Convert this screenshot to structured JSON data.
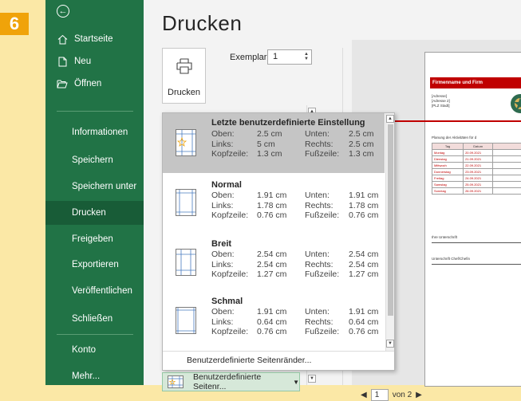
{
  "step": "6",
  "sidebar": {
    "top_items": [
      {
        "label": "Startseite",
        "icon": "home-icon"
      },
      {
        "label": "Neu",
        "icon": "new-document-icon"
      },
      {
        "label": "Öffnen",
        "icon": "folder-open-icon"
      }
    ],
    "items": [
      {
        "label": "Informationen"
      },
      {
        "label": "Speichern"
      },
      {
        "label": "Speichern unter"
      },
      {
        "label": "Drucken",
        "active": true
      },
      {
        "label": "Freigeben"
      },
      {
        "label": "Exportieren"
      },
      {
        "label": "Veröffentlichen"
      },
      {
        "label": "Schließen"
      }
    ],
    "bottom_items": [
      {
        "label": "Konto"
      },
      {
        "label": "Mehr..."
      }
    ]
  },
  "main": {
    "title": "Drucken",
    "print_button_label": "Drucken",
    "copies_label": "Exemplare:",
    "copies_value": "1"
  },
  "margin_dropdown": {
    "options": [
      {
        "title": "Letzte benutzerdefinierte Einstellung",
        "selected": true,
        "top_label": "Oben:",
        "top": "2.5 cm",
        "bottom_label": "Unten:",
        "bottom": "2.5 cm",
        "left_label": "Links:",
        "left": "5 cm",
        "right_label": "Rechts:",
        "right": "2.5 cm",
        "header_label": "Kopfzeile:",
        "header": "1.3 cm",
        "footer_label": "Fußzeile:",
        "footer": "1.3 cm"
      },
      {
        "title": "Normal",
        "top_label": "Oben:",
        "top": "1.91 cm",
        "bottom_label": "Unten:",
        "bottom": "1.91 cm",
        "left_label": "Links:",
        "left": "1.78 cm",
        "right_label": "Rechts:",
        "right": "1.78 cm",
        "header_label": "Kopfzeile:",
        "header": "0.76 cm",
        "footer_label": "Fußzeile:",
        "footer": "0.76 cm"
      },
      {
        "title": "Breit",
        "top_label": "Oben:",
        "top": "2.54 cm",
        "bottom_label": "Unten:",
        "bottom": "2.54 cm",
        "left_label": "Links:",
        "left": "2.54 cm",
        "right_label": "Rechts:",
        "right": "2.54 cm",
        "header_label": "Kopfzeile:",
        "header": "1.27 cm",
        "footer_label": "Fußzeile:",
        "footer": "1.27 cm"
      },
      {
        "title": "Schmal",
        "top_label": "Oben:",
        "top": "1.91 cm",
        "bottom_label": "Unten:",
        "bottom": "1.91 cm",
        "left_label": "Links:",
        "left": "0.64 cm",
        "right_label": "Rechts:",
        "right": "0.64 cm",
        "header_label": "Kopfzeile:",
        "header": "0.76 cm",
        "footer_label": "Fußzeile:",
        "footer": "0.76 cm"
      }
    ],
    "custom_link": "Benutzerdefinierte Seitenränder..."
  },
  "margin_combo_label": "Benutzerdefinierte Seitenr...",
  "preview": {
    "header": "Firmenname und Firm",
    "address": [
      "[Adresse]",
      "[Adresse 2]",
      "[PLZ Stadt]"
    ],
    "plan_title": "Planung der Aktivitäten für d",
    "table_headers": [
      "Tag",
      "Datum"
    ],
    "table_rows": [
      [
        "Montag",
        "20.09.2021"
      ],
      [
        "Dienstag",
        "21.09.2021"
      ],
      [
        "Mittwoch",
        "22.09.2021"
      ],
      [
        "Donnerstag",
        "23.09.2021"
      ],
      [
        "Freitag",
        "24.09.2021"
      ],
      [
        "Samstag",
        "25.09.2021"
      ],
      [
        "Sonntag",
        "26.09.2021"
      ]
    ],
    "signature_1": "Ihre Unterschrift",
    "signature_2": "Unterschrift Chef/Chefin"
  },
  "pager": {
    "current": "1",
    "total_text": "von 2"
  },
  "colors": {
    "sidebar": "#217346",
    "sidebar_active": "#185c37",
    "accent_red": "#c00000",
    "badge": "#f0a30a"
  }
}
